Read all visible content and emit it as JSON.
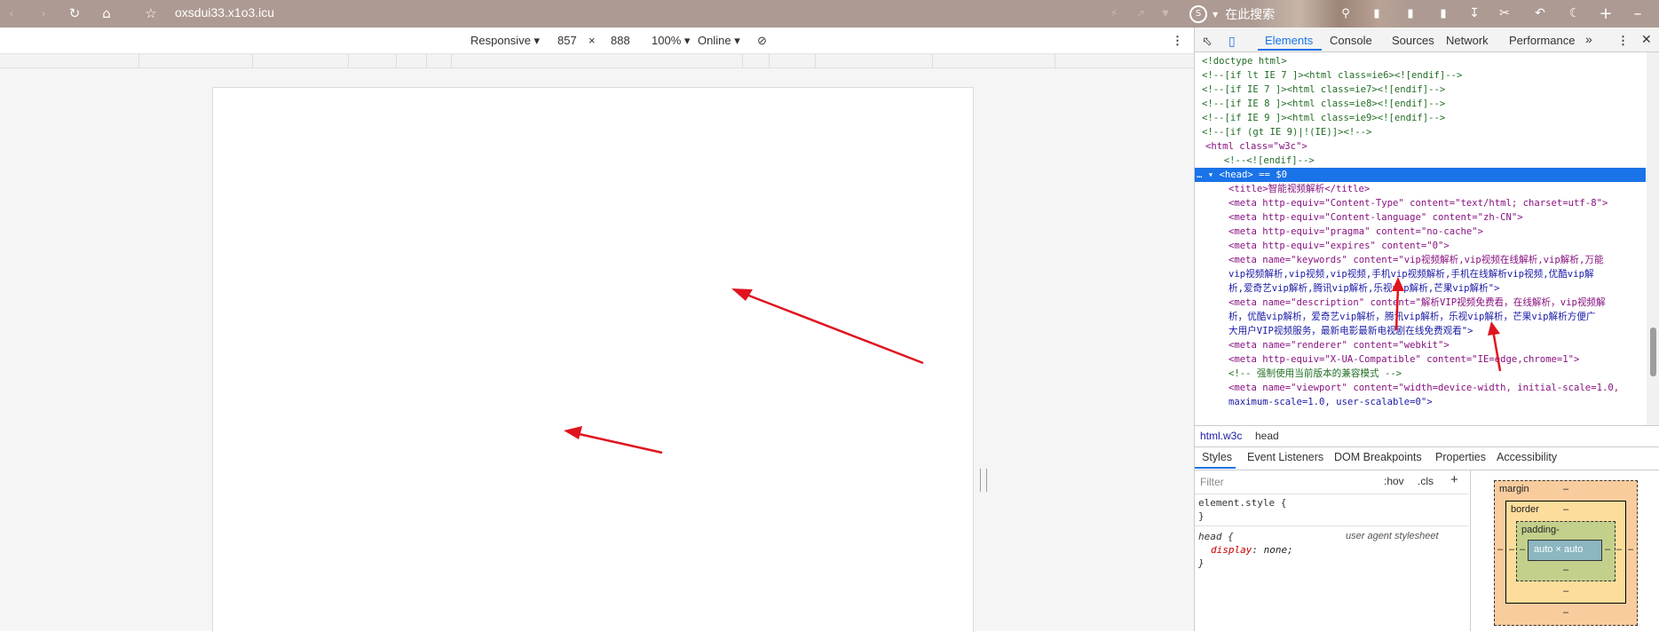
{
  "browser": {
    "url": "oxsdui33.x1o3.icu",
    "search_label": "在此搜索"
  },
  "device_toolbar": {
    "mode": "Responsive",
    "width": "857",
    "times": "×",
    "height": "888",
    "zoom": "100%",
    "network": "Online"
  },
  "devtools": {
    "tabs": [
      "Elements",
      "Console",
      "Sources",
      "Network",
      "Performance"
    ],
    "more": "»",
    "breadcrumb": [
      "html.w3c",
      "head"
    ],
    "styles_tabs": [
      "Styles",
      "Event Listeners",
      "DOM Breakpoints",
      "Properties",
      "Accessibility"
    ],
    "filter_placeholder": "Filter",
    "hov": ":hov",
    "cls": ".cls",
    "plus": "+",
    "rules": {
      "element_style": "element.style {",
      "close": "}",
      "head_selector": "head {",
      "source": "user agent stylesheet",
      "prop": "display",
      "value": "none;"
    },
    "box_model": {
      "margin": "margin",
      "border": "border",
      "padding": "padding-",
      "content": "auto × auto",
      "dash": "–"
    }
  },
  "dom": [
    {
      "text": "<!doctype html>",
      "cls": "cm"
    },
    {
      "text": "<!--[if lt IE 7 ]><html class=ie6><![endif]-->",
      "cls": "cm"
    },
    {
      "text": "<!--[if IE 7 ]><html class=ie7><![endif]-->",
      "cls": "cm"
    },
    {
      "text": "<!--[if IE 8 ]><html class=ie8><![endif]-->",
      "cls": "cm"
    },
    {
      "text": "<!--[if IE 9 ]><html class=ie9><![endif]-->",
      "cls": "cm"
    },
    {
      "text": "<!--[if (gt IE 9)|!(IE)]><!-->",
      "cls": "cm"
    },
    {
      "text": "<html class=\"w3c\">",
      "cls": "tg"
    },
    {
      "text": "  <!--<![endif]-->",
      "cls": "cm"
    },
    {
      "text": "<head> == $0",
      "cls": "tg",
      "selected": true
    },
    {
      "text": "<title>智能视频解析</title>",
      "cls": "tg"
    },
    {
      "text": "<meta http-equiv=\"Content-Type\" content=\"text/html; charset=utf-8\">",
      "cls": "tg"
    },
    {
      "text": "<meta http-equiv=\"Content-language\" content=\"zh-CN\">",
      "cls": "tg"
    },
    {
      "text": "<meta http-equiv=\"pragma\" content=\"no-cache\">",
      "cls": "tg"
    },
    {
      "text": "<meta http-equiv=\"expires\" content=\"0\">",
      "cls": "tg"
    },
    {
      "text": "<meta name=\"keywords\" content=\"vip视频解析,vip视频在线解析,vip解析,万能",
      "cls": "tg"
    },
    {
      "text": "vip视频解析,vip视频,vip视频,手机vip视频解析,手机在线解析vip视频,优酷vip解",
      "cls": "av"
    },
    {
      "text": "析,爱奇艺vip解析,腾讯vip解析,乐视vip解析,芒果vip解析\">",
      "cls": "av"
    },
    {
      "text": "<meta name=\"description\" content=\"解析VIP视频免费看，在线解析，vip视频解",
      "cls": "tg"
    },
    {
      "text": "析，优酷vip解析，爱奇艺vip解析，腾讯vip解析，乐视vip解析，芒果vip解析方便广",
      "cls": "av"
    },
    {
      "text": "大用户VIP视频服务，最新电影最新电视剧在线免费观看\">",
      "cls": "av"
    },
    {
      "text": "<meta name=\"renderer\" content=\"webkit\">",
      "cls": "tg"
    },
    {
      "text": "<meta http-equiv=\"X-UA-Compatible\" content=\"IE=edge,chrome=1\">",
      "cls": "tg"
    },
    {
      "text": "<!-- 强制使用当前版本的兼容模式 -->",
      "cls": "cm"
    },
    {
      "text": "<meta name=\"viewport\" content=\"width=device-width, initial-scale=1.0,",
      "cls": "tg"
    },
    {
      "text": "maximum-scale=1.0, user-scalable=0\">",
      "cls": "av"
    }
  ],
  "icons": [
    "back-icon",
    "forward-icon",
    "reload-icon",
    "home-icon",
    "star-icon",
    "search-engine-icon",
    "inspect-icon",
    "device-toggle-icon",
    "kebab-menu-icon",
    "close-icon",
    "rotate-icon"
  ],
  "colors": {
    "accent": "#1a73e8",
    "topbar": "#ad9a92",
    "annotation_arrow": "#e0141e"
  }
}
